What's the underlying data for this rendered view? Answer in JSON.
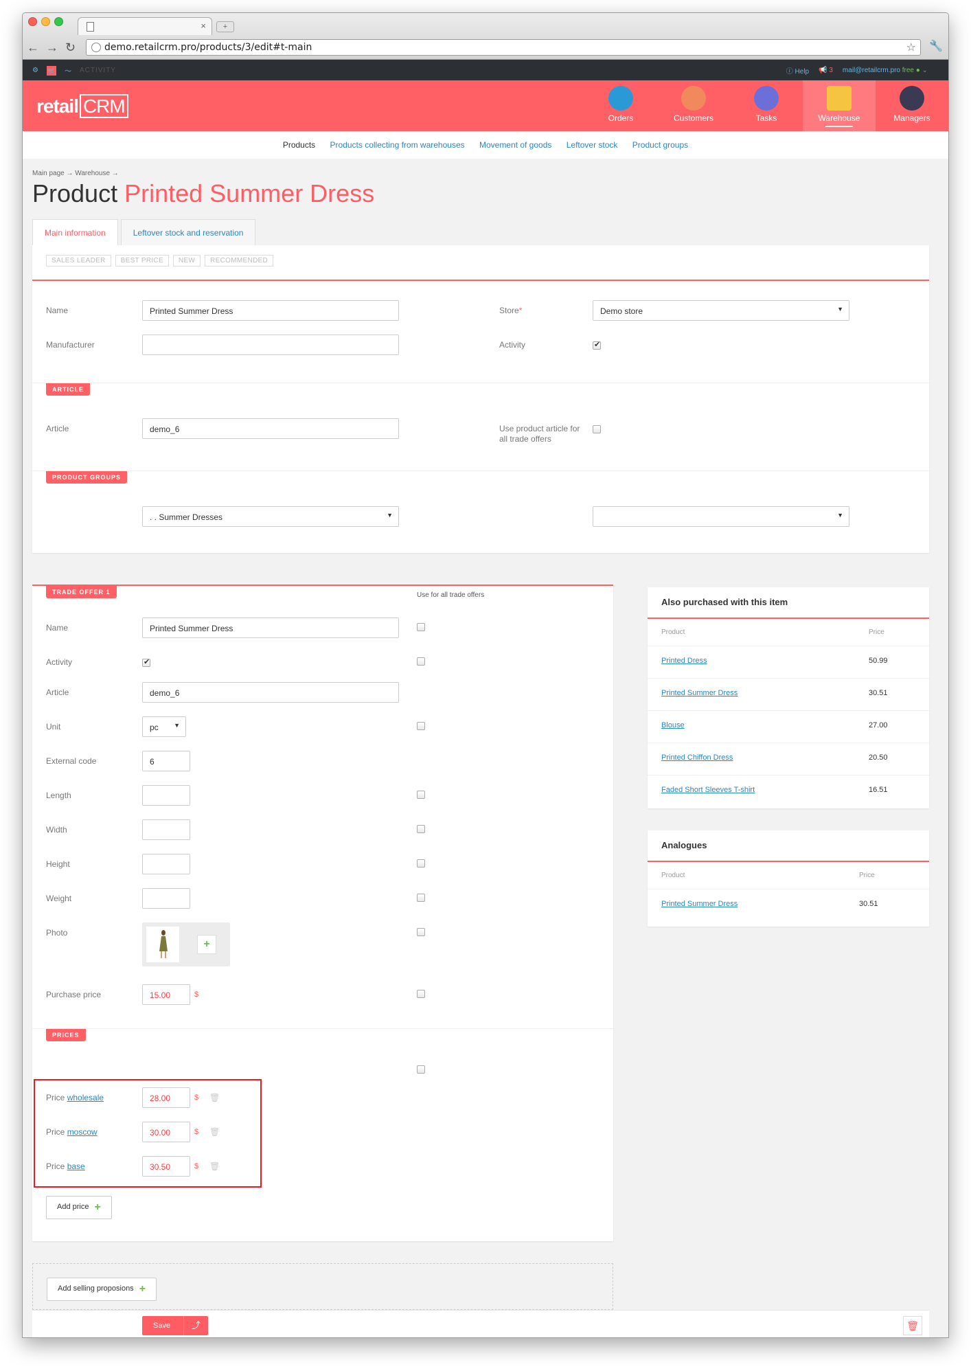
{
  "browser": {
    "tab_title": "",
    "url": "demo.retailcrm.pro/products/3/edit#t-main"
  },
  "topbar": {
    "activity": "ACTIVITY",
    "help": "Help",
    "notifications": "3",
    "email": "mail@retailcrm.pro",
    "plan": "free"
  },
  "header": {
    "logo_retail": "retail",
    "logo_crm": "CRM",
    "modules": [
      {
        "label": "Orders",
        "icon": "cart-icon"
      },
      {
        "label": "Customers",
        "icon": "customer-avatar-icon"
      },
      {
        "label": "Tasks",
        "icon": "tasks-icon"
      },
      {
        "label": "Warehouse",
        "icon": "box-icon"
      },
      {
        "label": "Managers",
        "icon": "manager-avatar-icon"
      }
    ]
  },
  "subnav": [
    "Products",
    "Products collecting from warehouses",
    "Movement of goods",
    "Leftover stock",
    "Product groups"
  ],
  "breadcrumb": "Main page → Warehouse →",
  "page_title": {
    "prefix": "Product",
    "name": "Printed Summer Dress"
  },
  "tabs": [
    "Main information",
    "Leftover stock and reservation"
  ],
  "tags": [
    "SALES LEADER",
    "BEST PRICE",
    "NEW",
    "RECOMMENDED"
  ],
  "main": {
    "name_label": "Name",
    "name_value": "Printed Summer Dress",
    "manufacturer_label": "Manufacturer",
    "manufacturer_value": "",
    "store_label": "Store",
    "store_required": "*",
    "store_value": "Demo store",
    "activity_label": "Activity",
    "article_section": "ARTICLE",
    "article_label": "Article",
    "article_value": "demo_6",
    "use_article_label_1": "Use product article for",
    "use_article_label_2": "all trade offers",
    "groups_section": "PRODUCT GROUPS",
    "group_value": ". . Summer Dresses",
    "group2_value": ""
  },
  "offer": {
    "section": "TRADE OFFER 1",
    "use_all": "Use for all trade offers",
    "name_label": "Name",
    "name_value": "Printed Summer Dress",
    "activity_label": "Activity",
    "article_label": "Article",
    "article_value": "demo_6",
    "unit_label": "Unit",
    "unit_value": "pc",
    "ext_label": "External code",
    "ext_value": "6",
    "length_label": "Length",
    "width_label": "Width",
    "height_label": "Height",
    "weight_label": "Weight",
    "photo_label": "Photo",
    "purchase_label": "Purchase price",
    "purchase_value": "15.00",
    "currency": "$",
    "prices_section": "PRICES",
    "prices": [
      {
        "prefix": "Price",
        "type": "wholesale",
        "value": "28.00"
      },
      {
        "prefix": "Price",
        "type": "moscow",
        "value": "30.00"
      },
      {
        "prefix": "Price",
        "type": "base",
        "value": "30.50"
      }
    ],
    "add_price": "Add price"
  },
  "also_purchased": {
    "title": "Also purchased with this item",
    "col_product": "Product",
    "col_price": "Price",
    "rows": [
      {
        "name": "Printed Dress",
        "price": "50.99"
      },
      {
        "name": "Printed Summer Dress",
        "price": "30.51"
      },
      {
        "name": "Blouse",
        "price": "27.00"
      },
      {
        "name": "Printed Chiffon Dress",
        "price": "20.50"
      },
      {
        "name": "Faded Short Sleeves T-shirt",
        "price": "16.51"
      }
    ]
  },
  "analogues": {
    "title": "Analogues",
    "col_product": "Product",
    "col_price": "Price",
    "rows": [
      {
        "name": "Printed Summer Dress",
        "price": "30.51"
      }
    ]
  },
  "add_selling": "Add selling proposions",
  "footer": {
    "save": "Save"
  },
  "colors": {
    "brand": "#ff6065",
    "link": "#2a86c4",
    "highlight": "#e41c24"
  }
}
